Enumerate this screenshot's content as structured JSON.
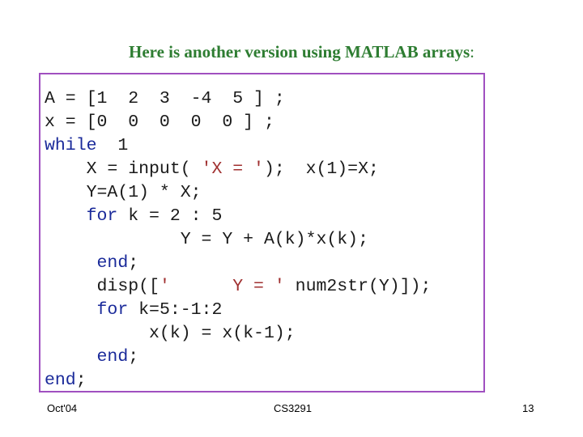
{
  "slide": {
    "title": "Here is another version using MATLAB arrays",
    "title_suffix": ":",
    "code_lines": [
      [
        {
          "t": "A = [1  2  3  -4  5 ] ;",
          "c": "plain"
        }
      ],
      [
        {
          "t": "x = [0  0  0  0  0 ] ;",
          "c": "plain"
        }
      ],
      [
        {
          "t": "while",
          "c": "kw"
        },
        {
          "t": "  1",
          "c": "plain"
        }
      ],
      [
        {
          "t": "    X = input( ",
          "c": "plain"
        },
        {
          "t": "'X = '",
          "c": "str"
        },
        {
          "t": ");  x(1)=X;",
          "c": "plain"
        }
      ],
      [
        {
          "t": "    Y=A(1) * X;",
          "c": "plain"
        }
      ],
      [
        {
          "t": "    ",
          "c": "plain"
        },
        {
          "t": "for",
          "c": "kw"
        },
        {
          "t": " k = 2 : 5",
          "c": "plain"
        }
      ],
      [
        {
          "t": "             Y = Y + A(k)*x(k);",
          "c": "plain"
        }
      ],
      [
        {
          "t": "     ",
          "c": "plain"
        },
        {
          "t": "end",
          "c": "kw"
        },
        {
          "t": ";",
          "c": "plain"
        }
      ],
      [
        {
          "t": "     disp([",
          "c": "plain"
        },
        {
          "t": "'      Y = '",
          "c": "str"
        },
        {
          "t": " num2str(Y)]);",
          "c": "plain"
        }
      ],
      [
        {
          "t": "     ",
          "c": "plain"
        },
        {
          "t": "for",
          "c": "kw"
        },
        {
          "t": " k=5:-1:2",
          "c": "plain"
        }
      ],
      [
        {
          "t": "          x(k) = x(k-1);",
          "c": "plain"
        }
      ],
      [
        {
          "t": "     ",
          "c": "plain"
        },
        {
          "t": "end",
          "c": "kw"
        },
        {
          "t": ";",
          "c": "plain"
        }
      ],
      [
        {
          "t": "end",
          "c": "kw"
        },
        {
          "t": ";",
          "c": "plain"
        }
      ]
    ],
    "colors": {
      "title": "#2e7d32",
      "border": "#a050c0",
      "keyword": "#1a2a9a",
      "string": "#a03030"
    }
  },
  "footer": {
    "left": "Oct'04",
    "center": "CS3291",
    "page_number": "13"
  }
}
